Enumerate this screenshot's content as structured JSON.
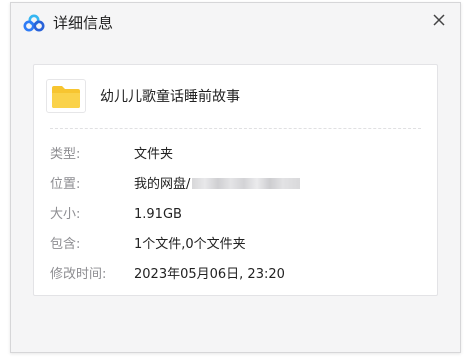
{
  "window": {
    "title": "详细信息",
    "app_icon": "baidu-netdisk-logo",
    "close_icon": "close-x-icon"
  },
  "file": {
    "icon": "folder-icon",
    "name": "幼儿儿歌童话睡前故事"
  },
  "details": [
    {
      "key": "type",
      "label": "类型:",
      "value": "文件夹"
    },
    {
      "key": "location",
      "label": "位置:",
      "value": "我的网盘/"
    },
    {
      "key": "size",
      "label": "大小:",
      "value": "1.91GB"
    },
    {
      "key": "contains",
      "label": "包含:",
      "value": "1个文件,0个文件夹"
    },
    {
      "key": "modified",
      "label": "修改时间:",
      "value": "2023年05月06日, 23:20"
    }
  ],
  "colors": {
    "folder": "#f7c530",
    "logo_blue": "#2f7cf6",
    "logo_cyan": "#35b6f1",
    "logo_dark": "#2962d9"
  }
}
